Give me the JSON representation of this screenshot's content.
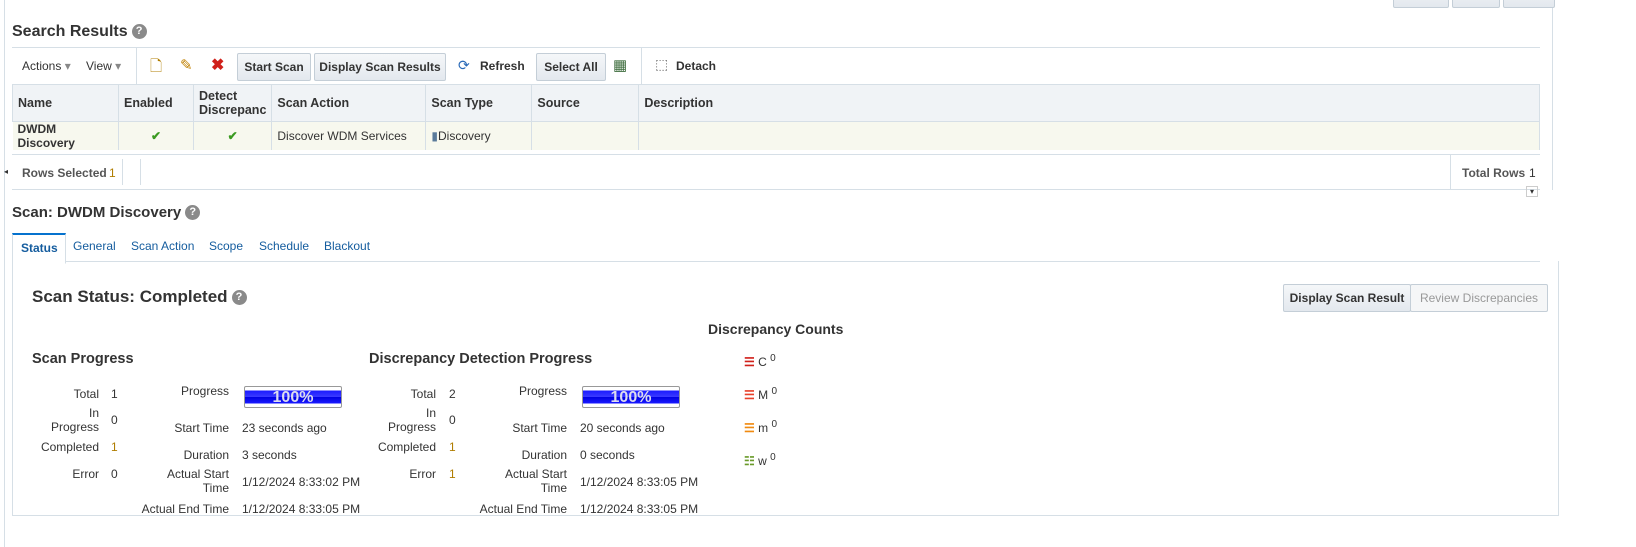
{
  "search_results": {
    "title": "Search Results",
    "toolbar": {
      "actions": "Actions",
      "view": "View",
      "start_scan": "Start Scan",
      "display_scan_results": "Display Scan Results",
      "refresh": "Refresh",
      "select_all": "Select All",
      "detach": "Detach"
    },
    "columns": [
      "Name",
      "Enabled",
      "Detect Discrepanc",
      "Scan Action",
      "Scan Type",
      "Source",
      "Description"
    ],
    "rows": [
      {
        "name": "DWDM Discovery",
        "enabled": "✔",
        "detect": "✔",
        "scan_action": "Discover WDM Services",
        "scan_type": "Discovery",
        "source": "",
        "description": ""
      }
    ],
    "footer": {
      "rows_selected_label": "Rows Selected",
      "rows_selected": "1",
      "total_rows_label": "Total Rows",
      "total_rows": "1"
    }
  },
  "scan": {
    "title": "Scan: DWDM Discovery",
    "tabs": [
      "Status",
      "General",
      "Scan Action",
      "Scope",
      "Schedule",
      "Blackout"
    ],
    "status_title": "Scan Status: Completed",
    "display_scan_result": "Display Scan Result",
    "review_discrepancies": "Review Discrepancies",
    "discrepancy_counts": {
      "title": "Discrepancy Counts",
      "items": [
        {
          "label": "C",
          "value": "0",
          "color": "#d0201a"
        },
        {
          "label": "M",
          "value": "0",
          "color": "#e8402a"
        },
        {
          "label": "m",
          "value": "0",
          "color": "#f08a10"
        },
        {
          "label": "w",
          "value": "0",
          "color": "#6a9a2a"
        }
      ]
    },
    "scan_progress": {
      "title": "Scan Progress",
      "total_label": "Total",
      "total": "1",
      "in_progress_label": "In Progress",
      "in_progress": "0",
      "completed_label": "Completed",
      "completed": "1",
      "error_label": "Error",
      "error": "0",
      "progress_label": "Progress",
      "progress": "100%",
      "start_time_label": "Start Time",
      "start_time": "23 seconds ago",
      "duration_label": "Duration",
      "duration": "3 seconds",
      "actual_start_label": "Actual Start Time",
      "actual_start": "1/12/2024 8:33:02 PM",
      "actual_end_label": "Actual End Time",
      "actual_end": "1/12/2024 8:33:05 PM"
    },
    "detection_progress": {
      "title": "Discrepancy Detection Progress",
      "total_label": "Total",
      "total": "2",
      "in_progress_label": "In Progress",
      "in_progress": "0",
      "completed_label": "Completed",
      "completed": "1",
      "error_label": "Error",
      "error": "1",
      "progress_label": "Progress",
      "progress": "100%",
      "start_time_label": "Start Time",
      "start_time": "20 seconds ago",
      "duration_label": "Duration",
      "duration": "0 seconds",
      "actual_start_label": "Actual Start Time",
      "actual_start": "1/12/2024 8:33:05 PM",
      "actual_end_label": "Actual End Time",
      "actual_end": "1/12/2024 8:33:05 PM"
    }
  }
}
